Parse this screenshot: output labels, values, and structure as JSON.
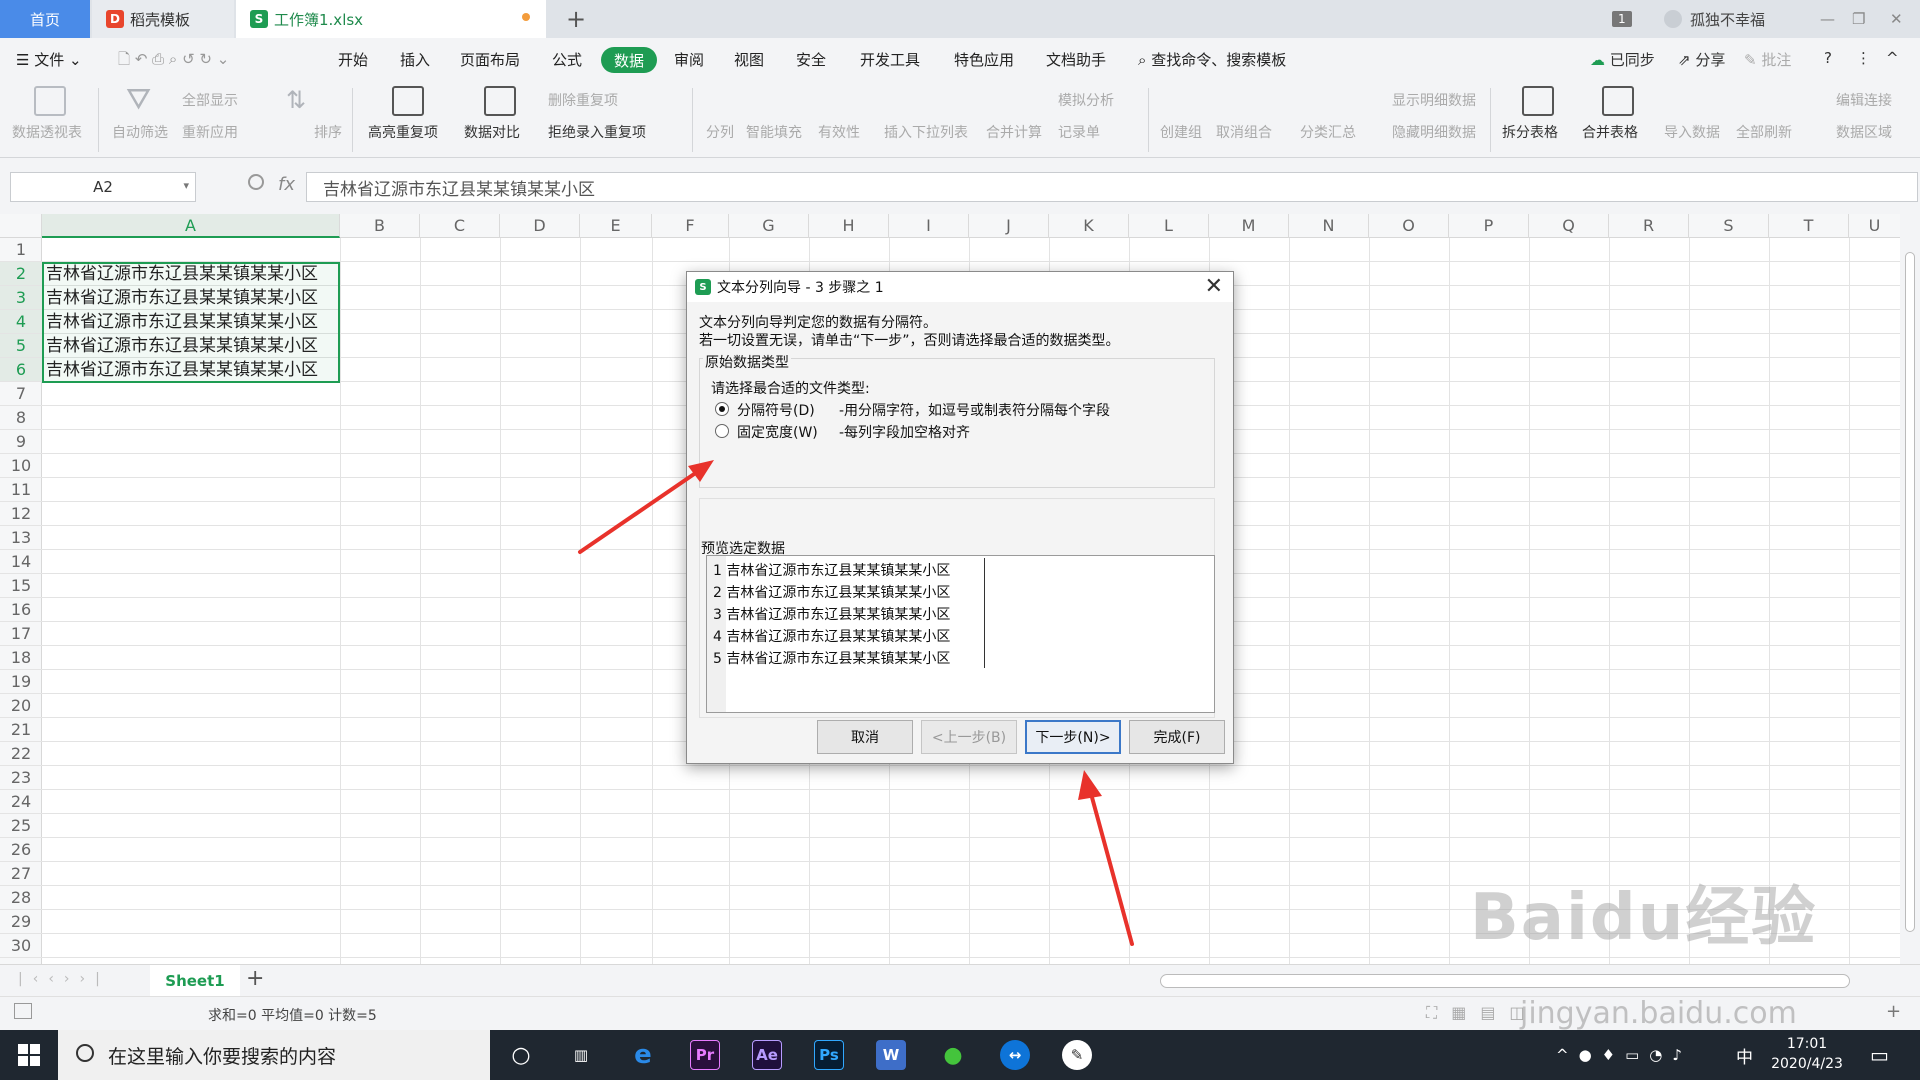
{
  "tabs": {
    "home": "首页",
    "template": "稻壳模板",
    "workbook": "工作簿1.xlsx",
    "new_tab": "+"
  },
  "titlebar": {
    "badge": "1",
    "user": "孤独不幸福"
  },
  "menu": {
    "file": "文件",
    "items": [
      "开始",
      "插入",
      "页面布局",
      "公式",
      "数据",
      "审阅",
      "视图",
      "安全",
      "开发工具",
      "特色应用",
      "文档助手"
    ],
    "active": "数据",
    "search": "查找命令、搜索模板",
    "sync": "已同步",
    "share": "分享",
    "comment": "批注"
  },
  "ribbon": {
    "pivot": "数据透视表",
    "autofilter": "自动筛选",
    "show_all": "全部显示",
    "reapply": "重新应用",
    "sort": "排序",
    "highlight_dup": "高亮重复项",
    "compare": "数据对比",
    "delete_dup": "删除重复项",
    "reject_dup": "拒绝录入重复项",
    "split": "分列",
    "smart_fill": "智能填充",
    "validity": "有效性",
    "dropdown": "插入下拉列表",
    "merge_calc": "合并计算",
    "simulate": "模拟分析",
    "record": "记录单",
    "create_group": "创建组",
    "ungroup": "取消组合",
    "subtotal": "分类汇总",
    "show_detail": "显示明细数据",
    "hide_detail": "隐藏明细数据",
    "split_table": "拆分表格",
    "merge_table": "合并表格",
    "import": "导入数据",
    "refresh_all": "全部刷新",
    "edit_link": "编辑连接",
    "data_area": "数据区域"
  },
  "formula_bar": {
    "name_box": "A2",
    "fx": "fx",
    "value": "吉林省辽源市东辽县某某镇某某小区"
  },
  "columns": [
    "A",
    "B",
    "C",
    "D",
    "E",
    "F",
    "G",
    "H",
    "I",
    "J",
    "K",
    "L",
    "M",
    "N",
    "O",
    "P",
    "Q",
    "R",
    "S",
    "T",
    "U"
  ],
  "rows": [
    "1",
    "2",
    "3",
    "4",
    "5",
    "6",
    "7",
    "8",
    "9",
    "10",
    "11",
    "12",
    "13",
    "14",
    "15",
    "16",
    "17",
    "18",
    "19",
    "20",
    "21",
    "22",
    "23",
    "24",
    "25",
    "26",
    "27",
    "28",
    "29",
    "30"
  ],
  "cells": {
    "A2": "吉林省辽源市东辽县某某镇某某小区",
    "A3": "吉林省辽源市东辽县某某镇某某小区",
    "A4": "吉林省辽源市东辽县某某镇某某小区",
    "A5": "吉林省辽源市东辽县某某镇某某小区",
    "A6": "吉林省辽源市东辽县某某镇某某小区"
  },
  "sheet": {
    "tab": "Sheet1",
    "add": "+"
  },
  "status": "求和=0  平均值=0  计数=5",
  "dialog": {
    "title": "文本分列向导 - 3 步骤之 1",
    "line1": "文本分列向导判定您的数据有分隔符。",
    "line2": "若一切设置无误，请单击“下一步”，否则请选择最合适的数据类型。",
    "group_title": "原始数据类型",
    "prompt": "请选择最合适的文件类型:",
    "option1_label": "分隔符号(D)",
    "option1_desc": "-用分隔字符，如逗号或制表符分隔每个字段",
    "option2_label": "固定宽度(W)",
    "option2_desc": "-每列字段加空格对齐",
    "selected_option": "分隔符号(D)",
    "preview_title": "预览选定数据",
    "preview": [
      "1  吉林省辽源市东辽县某某镇某某小区",
      "2  吉林省辽源市东辽县某某镇某某小区",
      "3  吉林省辽源市东辽县某某镇某某小区",
      "4  吉林省辽源市东辽县某某镇某某小区",
      "5  吉林省辽源市东辽县某某镇某某小区"
    ],
    "buttons": {
      "cancel": "取消",
      "prev": "<上一步(B)",
      "next": "下一步(N)>",
      "finish": "完成(F)"
    }
  },
  "taskbar": {
    "search_placeholder": "在这里输入你要搜索的内容",
    "ime": "中",
    "time": "17:01",
    "date": "2020/4/23"
  },
  "watermark": {
    "logo": "Baidu经验",
    "url": "jingyan.baidu.com"
  },
  "colors": {
    "accent": "#1e9c53",
    "annotation": "#e8322b",
    "home_tab": "#4a8be8"
  }
}
